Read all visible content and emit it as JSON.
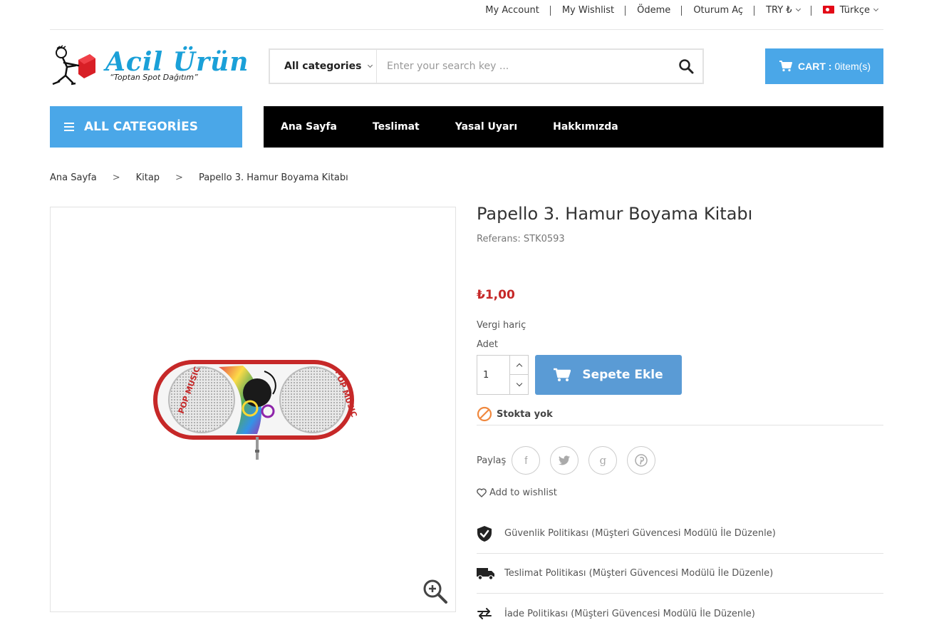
{
  "topbar": {
    "my_account": "My Account",
    "my_wishlist": "My Wishlist",
    "odeme": "Ödeme",
    "oturum_ac": "Oturum Aç",
    "currency": "TRY ₺",
    "language": "Türkçe"
  },
  "logo": {
    "title": "Acil Ürün",
    "tagline": "“Toptan Spot Dağıtım”"
  },
  "search": {
    "category": "All categories",
    "placeholder": "Enter your search key ..."
  },
  "cart": {
    "label": "CART :",
    "count": "0item(s)"
  },
  "nav": {
    "all_categories": "ALL CATEGORİES",
    "items": [
      "Ana Sayfa",
      "Teslimat",
      "Yasal Uyarı",
      "Hakkımızda"
    ]
  },
  "breadcrumb": [
    "Ana Sayfa",
    "Kitap",
    "Papello 3. Hamur Boyama Kitabı"
  ],
  "product": {
    "title": "Papello 3. Hamur Boyama Kitabı",
    "reference": "Referans: STK0593",
    "price": "₺1,00",
    "tax_note": "Vergi hariç",
    "quantity_label": "Adet",
    "quantity_value": "1",
    "add_to_cart": "Sepete Ekle",
    "stock_status": "Stokta yok",
    "share_label": "Paylaş",
    "wishlist": "Add to wishlist",
    "image_texts": {
      "left": "POP MUSIC",
      "right": "POP MUSIC"
    }
  },
  "policies": [
    "Güvenlik Politikası (Müşteri Güvencesi Modülü İle Düzenle)",
    "Teslimat Politikası (Müşteri Güvencesi Modülü İle Düzenle)",
    "İade Politikası (Müşteri Güvencesi Modülü İle Düzenle)"
  ],
  "colors": {
    "accent_blue": "#4aa7e8",
    "button_blue": "#5a9bd5",
    "price_red": "#c62828",
    "nav_black": "#000000",
    "stock_orange": "#f0883e"
  }
}
